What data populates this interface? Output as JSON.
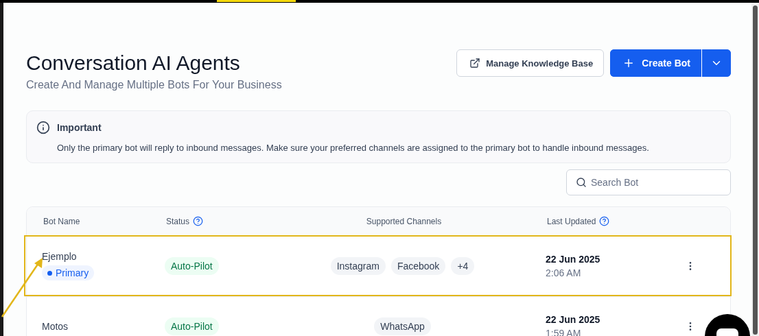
{
  "header": {
    "title": "Conversation AI Agents",
    "subtitle": "Create And Manage Multiple Bots For Your Business"
  },
  "actions": [
    {
      "kind": "outline",
      "label": "Manage Knowledge Base"
    },
    {
      "kind": "primary",
      "label": "Create Bot"
    }
  ],
  "notice": {
    "title": "Important",
    "text": "Only the primary bot will reply to inbound messages. Make sure your preferred channels are assigned to the primary bot to handle inbound messages."
  },
  "search": {
    "placeholder": "Search Bot"
  },
  "table": {
    "columns": [
      {
        "label": "Bot Name",
        "help": false
      },
      {
        "label": "Status",
        "help": true
      },
      {
        "label": "Supported Channels",
        "help": false
      },
      {
        "label": "Last Updated",
        "help": true
      }
    ],
    "rows": [
      {
        "name": "Ejemplo",
        "badge": "Primary",
        "status": "Auto-Pilot",
        "channels": [
          "Instagram",
          "Facebook",
          "+4"
        ],
        "date": "22 Jun 2025",
        "time": "2:06 AM",
        "highlighted": true
      },
      {
        "name": "Motos",
        "status": "Auto-Pilot",
        "channels": [
          "WhatsApp"
        ],
        "date": "22 Jun 2025",
        "time": "1:59 AM",
        "highlighted": false
      }
    ]
  }
}
